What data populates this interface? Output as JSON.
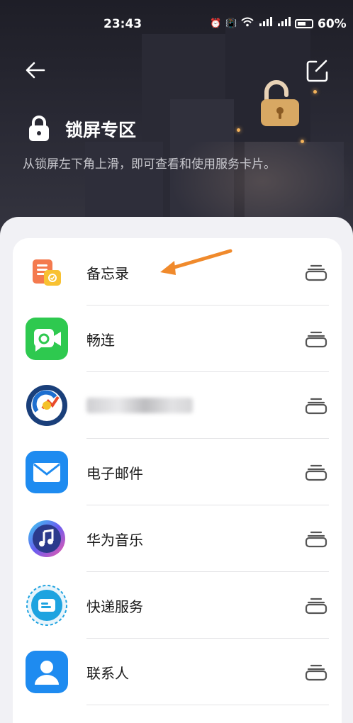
{
  "status": {
    "time": "23:43",
    "battery": "60%"
  },
  "header": {
    "title": "锁屏专区",
    "subtitle": "从锁屏左下角上滑，即可查看和使用服务卡片。"
  },
  "items": [
    {
      "label": "备忘录",
      "icon": "memo-icon"
    },
    {
      "label": "畅连",
      "icon": "meetime-icon"
    },
    {
      "label": "",
      "icon": "app-icon-blurred"
    },
    {
      "label": "电子邮件",
      "icon": "email-icon"
    },
    {
      "label": "华为音乐",
      "icon": "music-icon"
    },
    {
      "label": "快递服务",
      "icon": "express-icon"
    },
    {
      "label": "联系人",
      "icon": "contacts-icon"
    }
  ],
  "colors": {
    "accent_arrow": "#f08a2c",
    "green": "#2ec94f",
    "blue": "#1e8bf0"
  }
}
